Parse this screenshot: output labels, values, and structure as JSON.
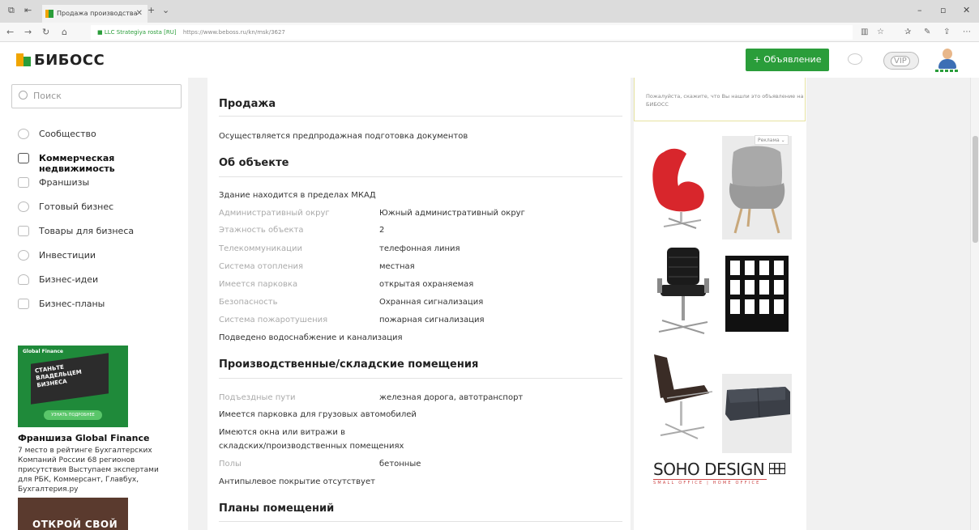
{
  "browser": {
    "tab_title": "Продажа производства",
    "cert_label": "LLC Strategiya rosta [RU]",
    "url": "https://www.beboss.ru/kn/msk/3627"
  },
  "header": {
    "logo_text": "БИБОСС",
    "post_button": "+ Объявление",
    "vip_label": "VIP"
  },
  "sidebar": {
    "search_placeholder": "Поиск",
    "items": [
      {
        "label": "Сообщество",
        "icon": "people-icon"
      },
      {
        "label": "Коммерческая недвижимость",
        "icon": "building-icon"
      },
      {
        "label": "Франшизы",
        "icon": "briefcase-icon"
      },
      {
        "label": "Готовый бизнес",
        "icon": "bulb-icon"
      },
      {
        "label": "Товары для бизнеса",
        "icon": "box-icon"
      },
      {
        "label": "Инвестиции",
        "icon": "coin-icon"
      },
      {
        "label": "Бизнес-идеи",
        "icon": "lightbulb-icon"
      },
      {
        "label": "Бизнес-планы",
        "icon": "document-icon"
      }
    ],
    "ad": {
      "brand": "Global Finance",
      "slogan": "СТАНЬТЕ ВЛАДЕЛЬЦЕМ БИЗНЕСА",
      "cta": "УЗНАТЬ ПОДРОБНЕЕ",
      "title": "Франшиза Global Finance",
      "description": "7 место в рейтинге Бухгалтерских Компаний России 68 регионов присутствия Выступаем экспертами для РБК, Коммерсант, Главбух, Бухгалтерия.ру"
    },
    "ad2_text": "ОТКРОЙ СВОЙ"
  },
  "listing": {
    "sale": {
      "heading": "Продажа",
      "text": "Осуществляется предпродажная подготовка документов"
    },
    "object": {
      "heading": "Об объекте",
      "note": "Здание находится в пределах МКАД",
      "rows": [
        {
          "key": "Административный округ",
          "value": "Южный административный округ"
        },
        {
          "key": "Этажность объекта",
          "value": "2"
        },
        {
          "key": "Телекоммуникации",
          "value": "телефонная линия"
        },
        {
          "key": "Система отопления",
          "value": "местная"
        },
        {
          "key": "Имеется парковка",
          "value": "открытая охраняемая"
        },
        {
          "key": "Безопасность",
          "value": "Охранная сигнализация"
        },
        {
          "key": "Система пожаротушения",
          "value": "пожарная сигнализация"
        }
      ],
      "footer_note": "Подведено водоснабжение и канализация"
    },
    "production": {
      "heading": "Производственные/складские помещения",
      "access_key": "Подъездные пути",
      "access_value": "железная дорога, автотранспорт",
      "truck_parking": "Имеется парковка для грузовых автомобилей",
      "windows_line1": "Имеются окна или витражи в",
      "windows_line2": "складских/производственных помещениях",
      "floors_key": "Полы",
      "floors_value": "бетонные",
      "dust": "Антипылевое покрытие отсутствует"
    },
    "plans": {
      "heading": "Планы помещений"
    }
  },
  "right": {
    "notice": "Пожалуйста, скажите, что Вы нашли это объявление на БИБОСС",
    "ad_tag": "Реклама",
    "brand": "SOHO DESIGN",
    "brand_sub": "SMALL OFFICE | HOME OFFICE"
  },
  "colors": {
    "brand_green": "#2a9d3a",
    "brand_orange": "#f0a500",
    "muted_key": "#aaaaaa"
  }
}
